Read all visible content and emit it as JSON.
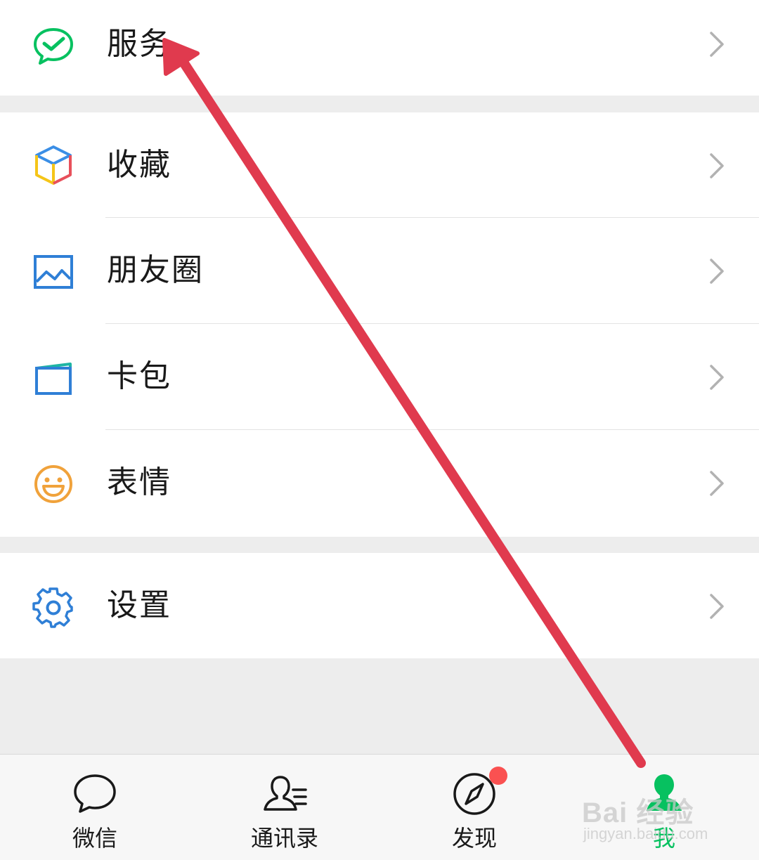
{
  "menu": {
    "services": {
      "label": "服务",
      "icon": "wechat-pay-check-icon"
    },
    "favorites": {
      "label": "收藏",
      "icon": "cube-icon"
    },
    "moments": {
      "label": "朋友圈",
      "icon": "picture-icon"
    },
    "cards": {
      "label": "卡包",
      "icon": "card-wallet-icon"
    },
    "stickers": {
      "label": "表情",
      "icon": "smiley-icon"
    },
    "settings": {
      "label": "设置",
      "icon": "gear-icon"
    }
  },
  "tabbar": {
    "tabs": [
      {
        "label": "微信",
        "icon": "chat-bubble-icon"
      },
      {
        "label": "通讯录",
        "icon": "contacts-icon"
      },
      {
        "label": "发现",
        "icon": "compass-icon",
        "badge": true
      },
      {
        "label": "我",
        "icon": "person-icon",
        "active": true
      }
    ],
    "active_color": "#07c160"
  },
  "watermark": {
    "main": "Bai 经验",
    "sub": "jingyan.baidu.com"
  },
  "colors": {
    "background": "#ededed",
    "row": "#ffffff",
    "annotation_arrow": "#e03a4e",
    "badge": "#fa5151"
  }
}
